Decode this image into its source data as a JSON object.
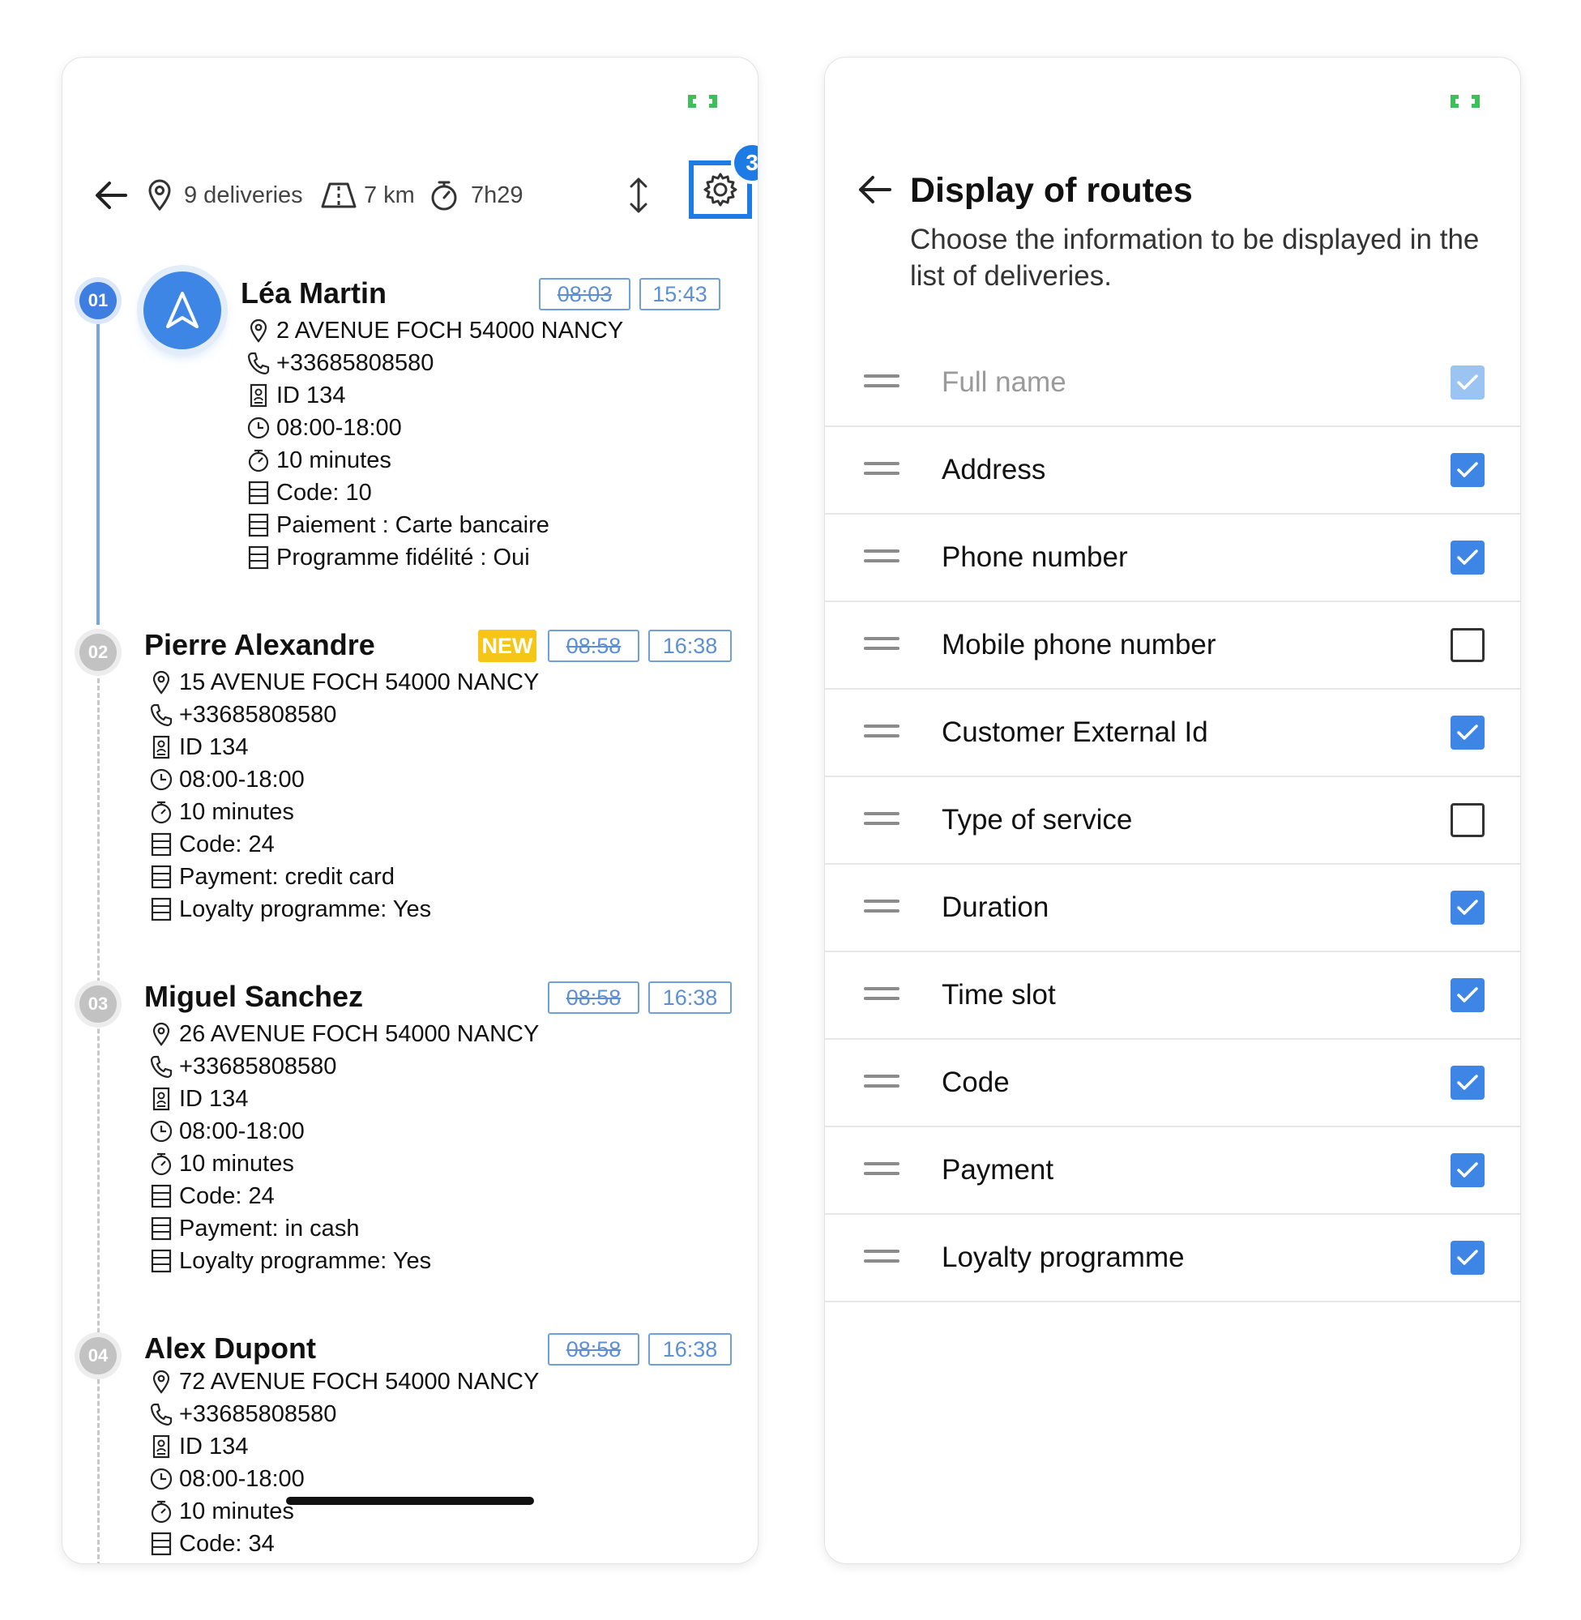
{
  "left": {
    "summary": {
      "deliveries": "9 deliveries",
      "distance": "7 km",
      "duration": "7h29"
    },
    "settings_badge": "3",
    "deliveries": [
      {
        "number": "01",
        "name": "Léa Martin",
        "planned": "08:03",
        "eta": "15:43",
        "is_new": false,
        "address": "2 AVENUE FOCH 54000 NANCY",
        "phone": "+33685808580",
        "id": "ID 134",
        "slot": "08:00-18:00",
        "service_time": "10 minutes",
        "code": "Code: 10",
        "payment": "Paiement : Carte bancaire",
        "loyalty": "Programme fidélité : Oui"
      },
      {
        "number": "02",
        "name": "Pierre Alexandre",
        "new_label": "NEW",
        "planned": "08:58",
        "eta": "16:38",
        "is_new": true,
        "address": "15 AVENUE FOCH 54000 NANCY",
        "phone": "+33685808580",
        "id": "ID 134",
        "slot": "08:00-18:00",
        "service_time": "10 minutes",
        "code": "Code: 24",
        "payment": "Payment: credit card",
        "loyalty": "Loyalty programme: Yes"
      },
      {
        "number": "03",
        "name": "Miguel Sanchez",
        "planned": "08:58",
        "eta": "16:38",
        "is_new": false,
        "address": "26 AVENUE FOCH 54000 NANCY",
        "phone": "+33685808580",
        "id": "ID 134",
        "slot": "08:00-18:00",
        "service_time": "10 minutes",
        "code": "Code: 24",
        "payment": "Payment: in cash",
        "loyalty": "Loyalty programme: Yes"
      },
      {
        "number": "04",
        "name": "Alex Dupont",
        "planned": "08:58",
        "eta": "16:38",
        "is_new": false,
        "address": "72 AVENUE FOCH 54000 NANCY",
        "phone": "+33685808580",
        "id": "ID 134",
        "slot": "08:00-18:00",
        "service_time": "10 minutes",
        "code": "Code: 34"
      }
    ]
  },
  "right": {
    "title": "Display of routes",
    "subtitle": "Choose the information to be displayed in the list of deliveries.",
    "options": [
      {
        "label": "Full name",
        "state": "disabled"
      },
      {
        "label": "Address",
        "state": "checked"
      },
      {
        "label": "Phone number",
        "state": "checked"
      },
      {
        "label": "Mobile phone number",
        "state": "unchecked"
      },
      {
        "label": "Customer External Id",
        "state": "checked"
      },
      {
        "label": "Type of service",
        "state": "unchecked"
      },
      {
        "label": "Duration",
        "state": "checked"
      },
      {
        "label": "Time slot",
        "state": "checked"
      },
      {
        "label": "Code",
        "state": "checked"
      },
      {
        "label": "Payment",
        "state": "checked"
      },
      {
        "label": "Loyalty programme",
        "state": "checked"
      }
    ]
  },
  "colors": {
    "accent": "#1e7be6",
    "checkbox": "#3d86e6",
    "brand": "#3fbf5a",
    "new_badge": "#f5c518",
    "time_tag": "#5c8fd6"
  },
  "icons": [
    "back-arrow-icon",
    "pin-icon",
    "road-icon",
    "stopwatch-icon",
    "sort-icon",
    "gear-icon",
    "navigation-icon",
    "phone-icon",
    "id-badge-icon",
    "clock-icon",
    "note-icon",
    "drag-handle-icon",
    "check-icon",
    "brand-logo-icon"
  ]
}
